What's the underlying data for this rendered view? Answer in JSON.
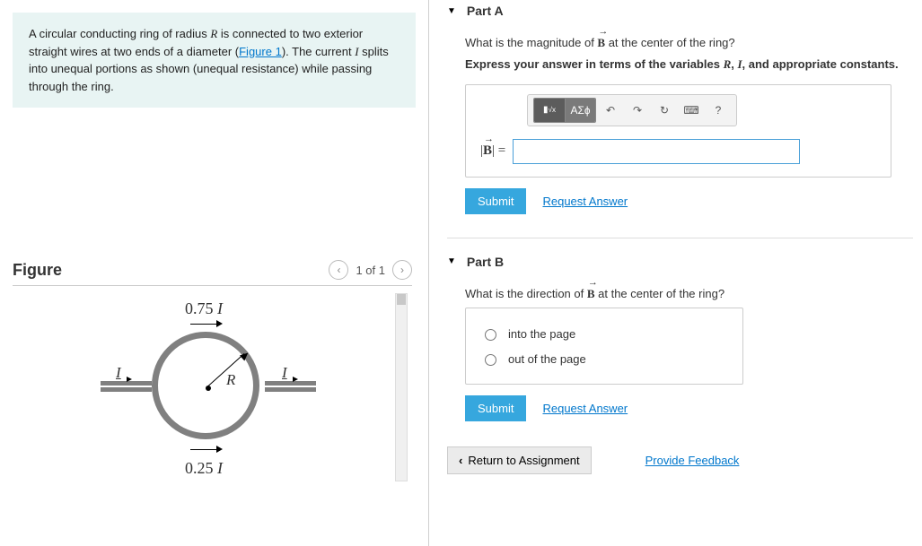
{
  "problem": {
    "intro_pre": "A circular conducting ring of radius ",
    "var_R": "R",
    "intro_mid1": " is connected to two exterior straight wires at two ends of a diameter (",
    "figure_link": "Figure 1",
    "intro_mid2": "). The current ",
    "var_I": "I",
    "intro_post": " splits into unequal portions as shown (unequal resistance) while passing through the ring."
  },
  "figure": {
    "heading": "Figure",
    "pager": "1 of 1",
    "top_value": "0.75",
    "top_var": "I",
    "bottom_value": "0.25",
    "bottom_var": "I",
    "radius_label": "R",
    "left_current": "I",
    "right_current": "I"
  },
  "partA": {
    "title": "Part A",
    "question_pre": "What is the magnitude of ",
    "vector": "B",
    "question_post": " at the center of the ring?",
    "instruction_pre": "Express your answer in terms of the variables ",
    "v1": "R",
    "sep": ", ",
    "v2": "I",
    "instruction_post": ", and appropriate constants.",
    "toolbar": {
      "templates": "√",
      "greek": "ΑΣɸ",
      "undo": "↶",
      "redo": "↷",
      "reset": "↻",
      "keyboard": "⌨",
      "help": "?"
    },
    "label_lhs": "|B⃗| =",
    "input_value": "",
    "submit": "Submit",
    "request": "Request Answer"
  },
  "partB": {
    "title": "Part B",
    "question_pre": "What is the direction of ",
    "vector": "B",
    "question_post": " at the center of the ring?",
    "options": [
      "into the page",
      "out of the page"
    ],
    "submit": "Submit",
    "request": "Request Answer"
  },
  "footer": {
    "return": "Return to Assignment",
    "feedback": "Provide Feedback"
  }
}
